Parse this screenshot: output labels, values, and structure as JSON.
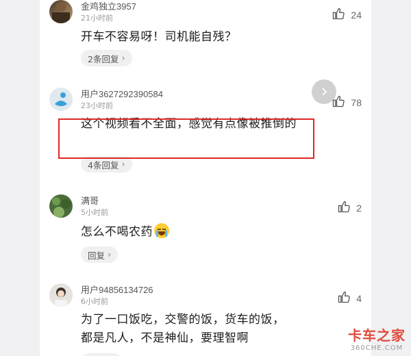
{
  "comments": [
    {
      "username": "金鸡独立3957",
      "time": "21小时前",
      "likes": "24",
      "text": "开车不容易呀！司机能自残？",
      "reply_label": "2条回复"
    },
    {
      "username": "用户3627292390584",
      "time": "23小时前",
      "likes": "78",
      "text": "这个视频看不全面，感觉有点像被推倒的",
      "reply_label": "4条回复"
    },
    {
      "username": "满哥",
      "time": "5小时前",
      "likes": "2",
      "text": "怎么不喝农药",
      "reply_label": "回复"
    },
    {
      "username": "用户94856134726",
      "time": "6小时前",
      "likes": "4",
      "text": "为了一口饭吃，交警的饭，货车的饭，都是凡人，不是神仙，要理智啊",
      "reply_label": ""
    }
  ],
  "watermark": {
    "main": "卡车之家",
    "sub": "360CHE.COM"
  },
  "colors": {
    "highlight": "#e02727",
    "watermark": "#e14b3c"
  }
}
